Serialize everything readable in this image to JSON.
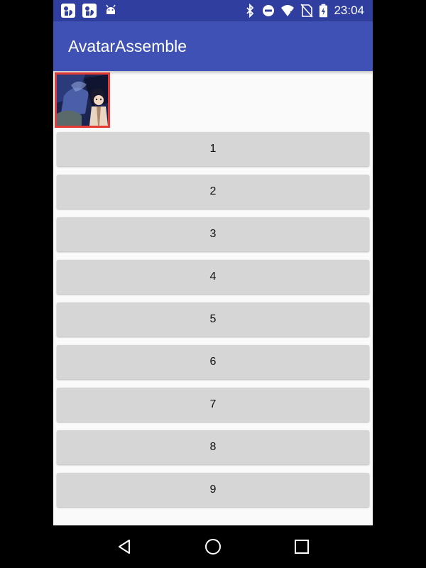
{
  "status_bar": {
    "time": "23:04",
    "notification_icons": [
      "app-notification-icon",
      "app-notification-icon",
      "android-icon"
    ],
    "system_icons": [
      "bluetooth-icon",
      "do-not-disturb-icon",
      "wifi-icon",
      "no-sim-icon",
      "battery-charging-icon"
    ]
  },
  "app_bar": {
    "title": "AvatarAssemble"
  },
  "buttons": [
    {
      "label": "1"
    },
    {
      "label": "2"
    },
    {
      "label": "3"
    },
    {
      "label": "4"
    },
    {
      "label": "5"
    },
    {
      "label": "6"
    },
    {
      "label": "7"
    },
    {
      "label": "8"
    },
    {
      "label": "9"
    }
  ],
  "nav_bar": {
    "items": [
      "back-icon",
      "home-icon",
      "recents-icon"
    ]
  },
  "colors": {
    "status_bar": "#303f9f",
    "app_bar": "#3f51b5",
    "avatar_border": "#e53935",
    "button_bg": "#d6d6d6",
    "background": "#fafafa"
  }
}
